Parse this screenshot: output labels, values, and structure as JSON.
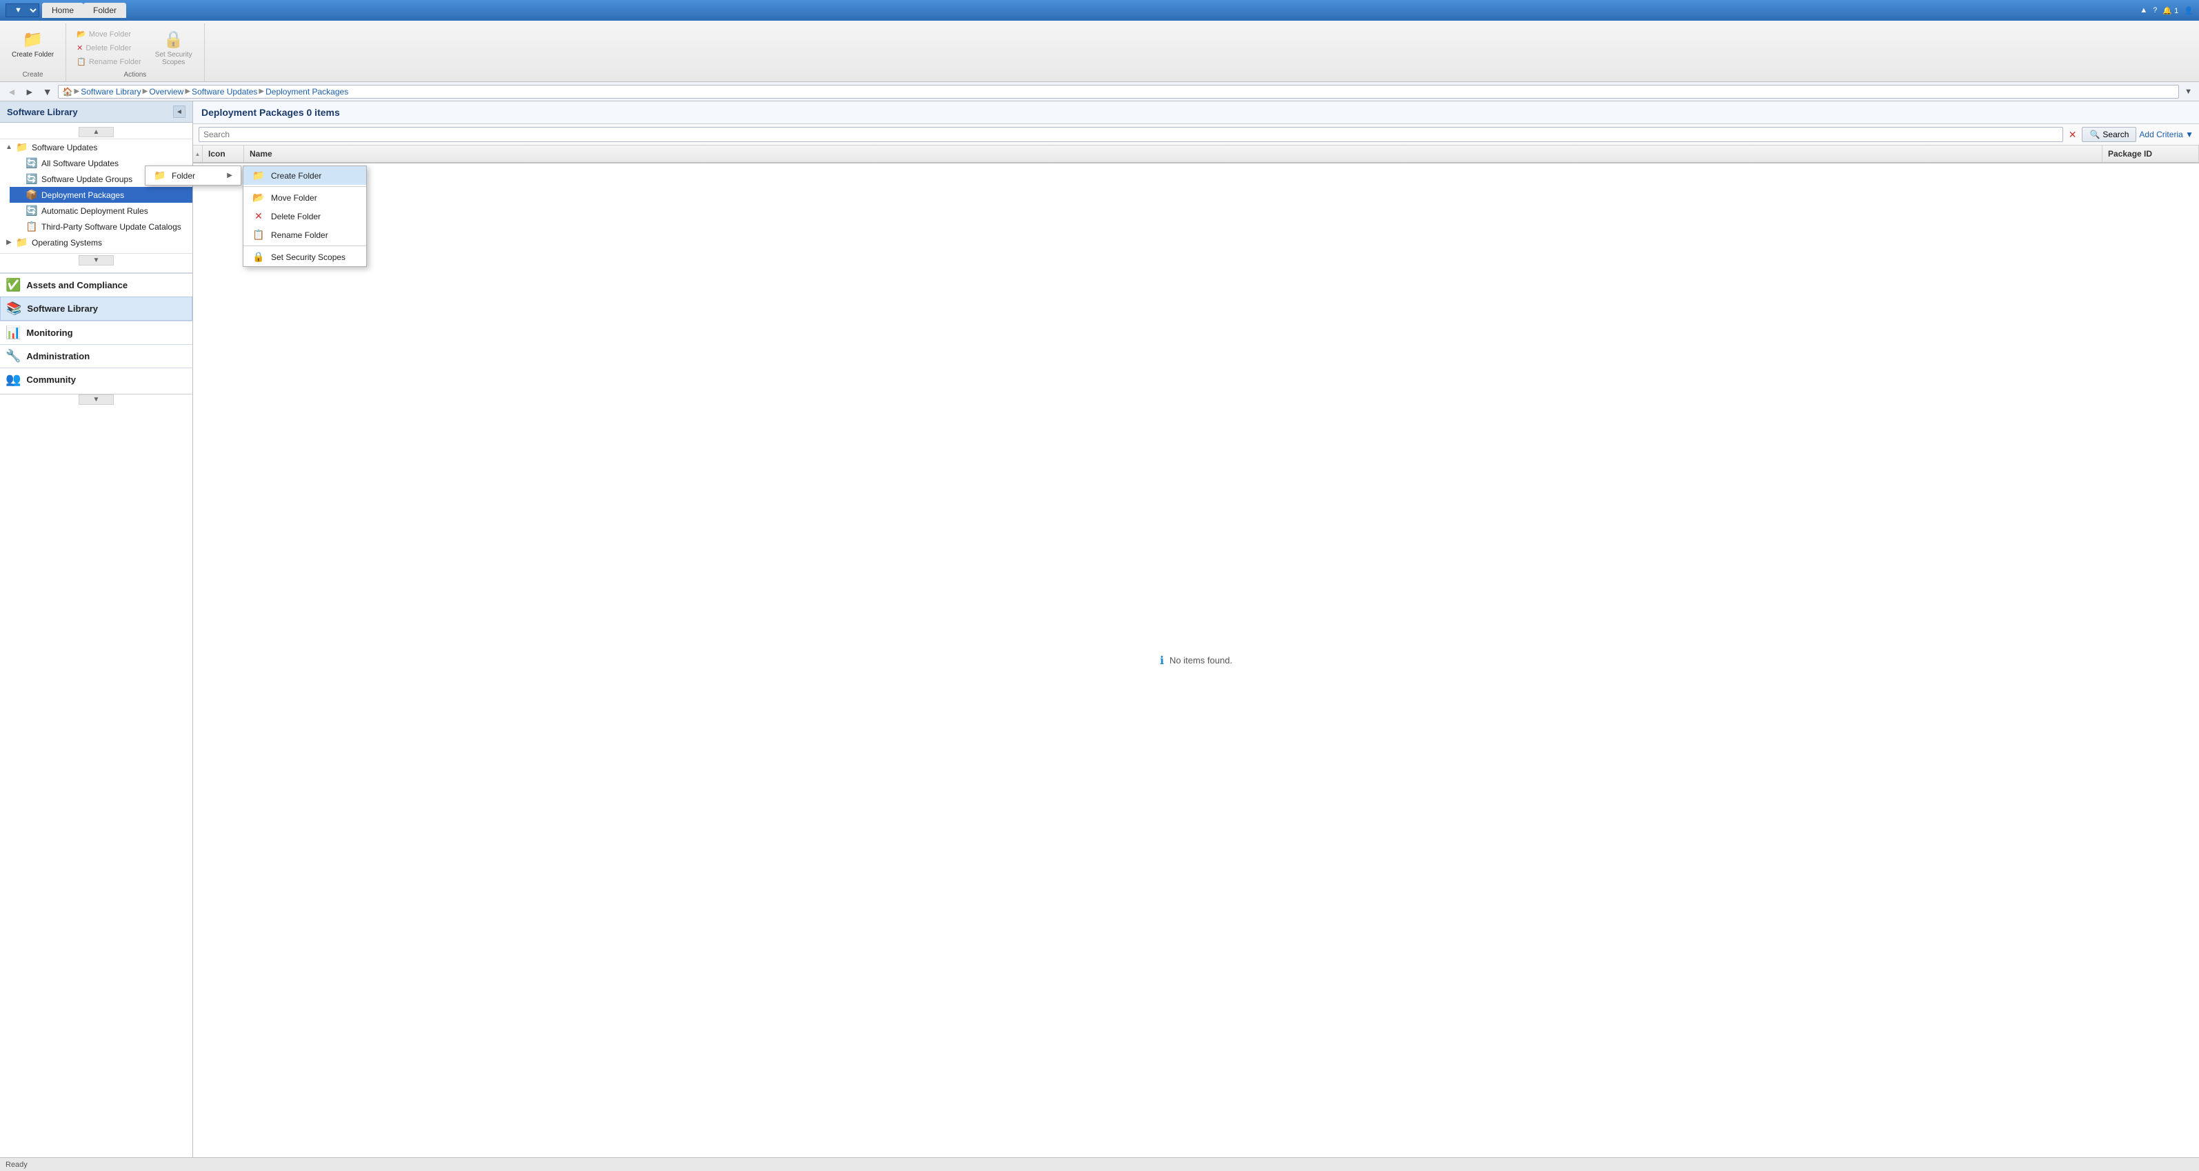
{
  "titlebar": {
    "tabs": [
      {
        "id": "home",
        "label": "Home"
      },
      {
        "id": "folder",
        "label": "Folder",
        "active": true
      }
    ],
    "right_items": [
      "▲",
      "?",
      "🔔 1",
      "👤"
    ]
  },
  "ribbon": {
    "create_group": {
      "label": "Create",
      "large_btn": {
        "icon": "📁",
        "label": "Create\nFolder"
      }
    },
    "actions_group": {
      "label": "Actions",
      "buttons": [
        {
          "label": "Move Folder",
          "icon": "📂",
          "disabled": true
        },
        {
          "label": "Delete Folder",
          "icon": "❌",
          "disabled": true
        },
        {
          "label": "Rename Folder",
          "icon": "📋",
          "disabled": true
        }
      ]
    },
    "security_btn": {
      "icon": "🔒",
      "label": "Set Security\nScopes",
      "disabled": true
    }
  },
  "addressbar": {
    "back_title": "Back",
    "forward_title": "Forward",
    "dropdown_title": "Dropdown",
    "breadcrumb": [
      {
        "label": "Software Library"
      },
      {
        "label": "Overview"
      },
      {
        "label": "Software Updates"
      },
      {
        "label": "Deployment Packages"
      }
    ],
    "expand_label": "▼"
  },
  "sidebar": {
    "title": "Software Library",
    "collapse_icon": "◄",
    "tree": [
      {
        "id": "software-updates",
        "label": "Software Updates",
        "icon": "⬆",
        "icon_color": "updates",
        "expanded": true,
        "level": 0,
        "toggle": "▲"
      },
      {
        "id": "all-software-updates",
        "label": "All Software Updates",
        "icon": "🔄",
        "level": 1
      },
      {
        "id": "software-update-groups",
        "label": "Software Update Groups",
        "icon": "🔄",
        "level": 1
      },
      {
        "id": "deployment-packages",
        "label": "Deployment Packages",
        "icon": "📦",
        "level": 1,
        "selected": true
      },
      {
        "id": "automatic-deployment-rules",
        "label": "Automatic Deployment Rules",
        "icon": "🔄",
        "level": 1
      },
      {
        "id": "third-party-catalogs",
        "label": "Third-Party Software Update Catalogs",
        "icon": "📋",
        "level": 1
      },
      {
        "id": "operating-systems",
        "label": "Operating Systems",
        "icon": "💻",
        "level": 0,
        "toggle": "▶"
      }
    ],
    "nav_sections": [
      {
        "id": "assets",
        "label": "Assets and Compliance",
        "icon": "✅"
      },
      {
        "id": "software-library",
        "label": "Software Library",
        "icon": "📚",
        "active": true
      },
      {
        "id": "monitoring",
        "label": "Monitoring",
        "icon": "📊"
      },
      {
        "id": "administration",
        "label": "Administration",
        "icon": "🔧"
      },
      {
        "id": "community",
        "label": "Community",
        "icon": "👥"
      }
    ]
  },
  "content": {
    "header": "Deployment Packages 0 items",
    "search_placeholder": "Search",
    "search_btn_label": "Search",
    "add_criteria_label": "Add Criteria ▼",
    "columns": [
      {
        "id": "icon",
        "label": "Icon"
      },
      {
        "id": "name",
        "label": "Name"
      },
      {
        "id": "package-id",
        "label": "Package ID"
      }
    ],
    "empty_message": "No items found."
  },
  "context_menu": {
    "item": {
      "label": "Folder",
      "arrow": "▶"
    }
  },
  "submenu": {
    "items": [
      {
        "id": "create-folder",
        "label": "Create Folder",
        "icon": "📁"
      },
      {
        "id": "move-folder",
        "label": "Move Folder",
        "icon": "📂"
      },
      {
        "id": "delete-folder",
        "label": "Delete Folder",
        "icon": "❌"
      },
      {
        "id": "rename-folder",
        "label": "Rename Folder",
        "icon": "📋"
      },
      {
        "id": "set-security",
        "label": "Set Security Scopes",
        "icon": "🔒"
      }
    ]
  },
  "statusbar": {
    "text": "Ready"
  }
}
